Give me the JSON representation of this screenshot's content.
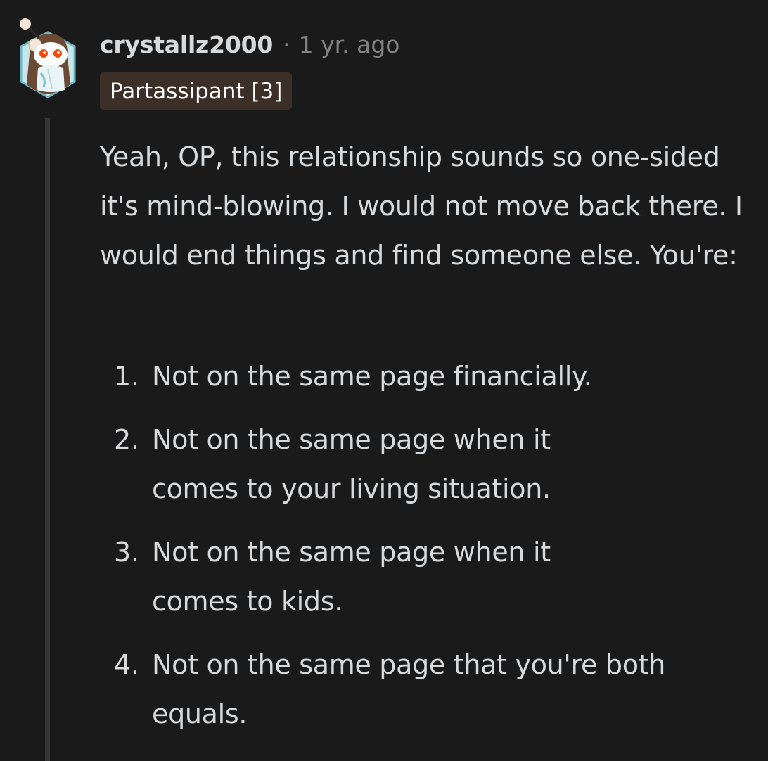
{
  "comment": {
    "username": "crystallz2000",
    "separator": "·",
    "timestamp": "1 yr. ago",
    "flair": "Partassipant [3]",
    "body": "Yeah, OP, this relationship sounds so one-sided it's mind-blowing. I would not move back there. I would end things and find someone else. You're:",
    "list": [
      {
        "number": "1.",
        "text": "Not on the same page financially."
      },
      {
        "number": "2.",
        "text": "Not on the same page when it comes to your living situation."
      },
      {
        "number": "3.",
        "text": "Not on the same page when it comes to kids."
      },
      {
        "number": "4.",
        "text": "Not on the same page that you're both equals."
      }
    ]
  },
  "colors": {
    "background": "#1a1a1b",
    "text": "#d7dadc",
    "muted": "#818384",
    "flair_bg": "#3b2f27",
    "thread_line": "#343536"
  },
  "icons": {
    "avatar": "snoo-avatar-icon"
  }
}
